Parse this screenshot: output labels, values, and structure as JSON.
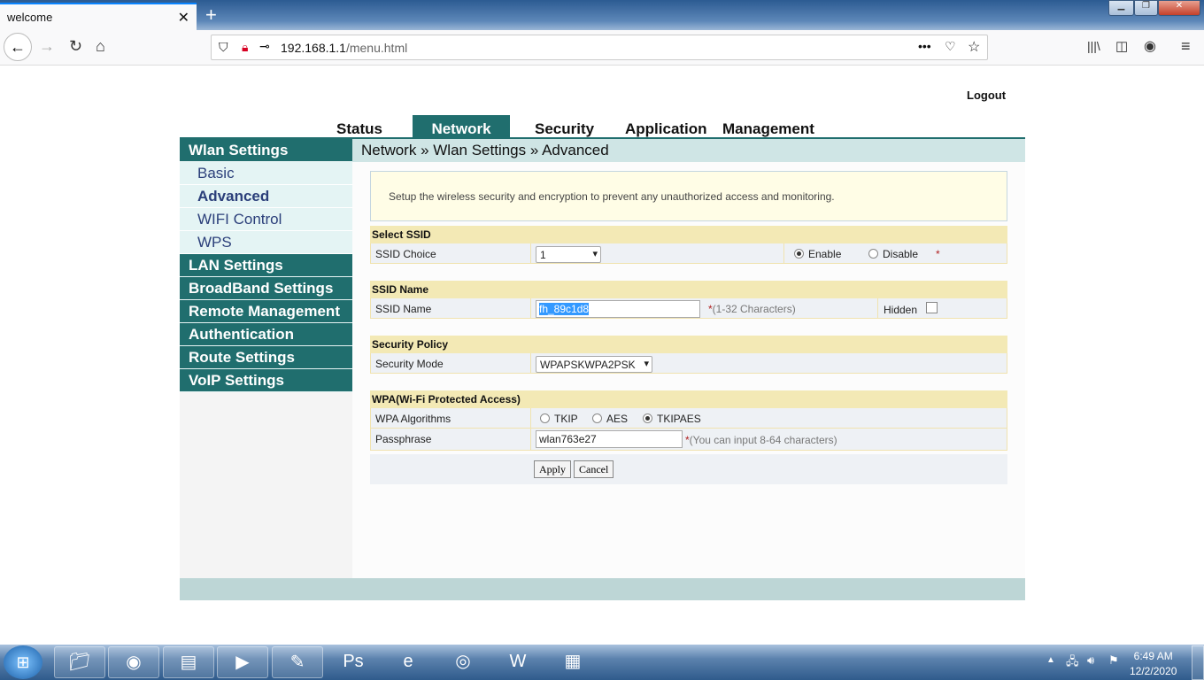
{
  "browser": {
    "tab_title": "welcome",
    "url_host": "192.168.1.1",
    "url_path": "/menu.html"
  },
  "header": {
    "logout": "Logout"
  },
  "nav": [
    "Status",
    "Network",
    "Security",
    "Application",
    "Management"
  ],
  "sidebar": {
    "sections": [
      "Wlan Settings",
      "LAN Settings",
      "BroadBand Settings",
      "Remote Management",
      "Authentication",
      "Route Settings",
      "VoIP Settings"
    ],
    "sub_items": [
      "Basic",
      "Advanced",
      "WIFI Control",
      "WPS"
    ]
  },
  "breadcrumb": "Network » Wlan Settings » Advanced",
  "info": "Setup the wireless security and encryption to prevent any unauthorized access and monitoring.",
  "select_ssid": {
    "title": "Select SSID",
    "label": "SSID Choice",
    "value": "1",
    "enable": "Enable",
    "disable": "Disable",
    "required": "*",
    "selected": "Enable"
  },
  "ssid_name": {
    "title": "SSID Name",
    "label": "SSID Name",
    "value": "fh_89c1d8",
    "hint": "(1-32 Characters)",
    "required": "*",
    "hidden_label": "Hidden",
    "hidden_checked": false
  },
  "security_policy": {
    "title": "Security Policy",
    "label": "Security Mode",
    "value": "WPAPSKWPA2PSK"
  },
  "wpa": {
    "title": "WPA(Wi-Fi Protected Access)",
    "alg_label": "WPA Algorithms",
    "algorithms": [
      "TKIP",
      "AES",
      "TKIPAES"
    ],
    "selected": "TKIPAES",
    "pass_label": "Passphrase",
    "pass_value": "wlan763e27",
    "pass_hint": "(You can input 8-64 characters)",
    "required": "*"
  },
  "buttons": {
    "apply": "Apply",
    "cancel": "Cancel"
  },
  "taskbar": {
    "time": "6:49 AM",
    "date": "12/2/2020"
  }
}
